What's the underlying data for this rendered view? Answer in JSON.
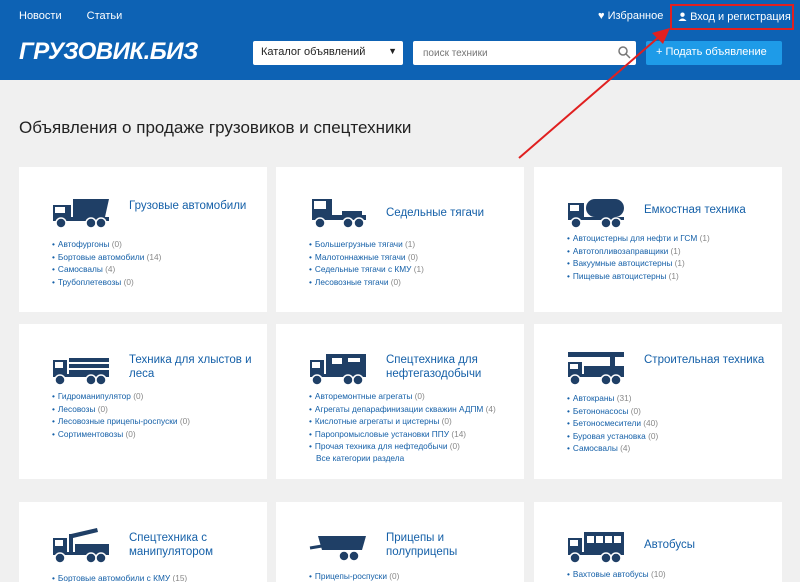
{
  "header": {
    "nav": [
      "Новости",
      "Статьи"
    ],
    "favorites": "Избранное",
    "login": "Вход и регистрация",
    "logo": "ГРУЗОВИК.БИЗ",
    "catalog_select": "Каталог объявлений",
    "search_placeholder": "поиск техники",
    "post_button": "+ Подать объявление"
  },
  "page_title": "Объявления о продаже грузовиков и спецтехники",
  "colors": {
    "header_bg": "#0d62b4",
    "accent": "#1e9be8",
    "link": "#1560a8",
    "highlight": "#e02020"
  },
  "cards": [
    {
      "title": "Грузовые автомобили",
      "icon": "dump-truck-icon",
      "items": [
        {
          "label": "Автофургоны",
          "count": "(0)"
        },
        {
          "label": "Бортовые автомобили",
          "count": "(14)"
        },
        {
          "label": "Самосвалы",
          "count": "(4)"
        },
        {
          "label": "Трубоплетевозы",
          "count": "(0)"
        }
      ]
    },
    {
      "title": "Седельные тягачи",
      "icon": "tractor-truck-icon",
      "items": [
        {
          "label": "Большегрузные тягачи",
          "count": "(1)"
        },
        {
          "label": "Малотоннажные тягачи",
          "count": "(0)"
        },
        {
          "label": "Седельные тягачи с КМУ",
          "count": "(1)"
        },
        {
          "label": "Лесовозные тягачи",
          "count": "(0)"
        }
      ]
    },
    {
      "title": "Емкостная техника",
      "icon": "tanker-truck-icon",
      "items": [
        {
          "label": "Автоцистерны для нефти и ГСМ",
          "count": "(1)"
        },
        {
          "label": "Автотопливозаправщики",
          "count": "(1)"
        },
        {
          "label": "Вакуумные автоцистерны",
          "count": "(1)"
        },
        {
          "label": "Пищевые автоцистерны",
          "count": "(1)"
        }
      ]
    },
    {
      "title": "Техника для хлыстов и леса",
      "icon": "timber-truck-icon",
      "items": [
        {
          "label": "Гидроманипулятор",
          "count": "(0)"
        },
        {
          "label": "Лесовозы",
          "count": "(0)"
        },
        {
          "label": "Лесовозные прицепы-роспуски",
          "count": "(0)"
        },
        {
          "label": "Сортиментовозы",
          "count": "(0)"
        }
      ]
    },
    {
      "title": "Спецтехника для нефтегазодобычи",
      "icon": "oilfield-truck-icon",
      "all": "Все категории раздела",
      "items": [
        {
          "label": "Авторемонтные агрегаты",
          "count": "(0)"
        },
        {
          "label": "Агрегаты депарафинизации скважин АДПМ",
          "count": "(4)"
        },
        {
          "label": "Кислотные агрегаты и цистерны",
          "count": "(0)"
        },
        {
          "label": "Паропромысловые установки ППУ",
          "count": "(14)"
        },
        {
          "label": "Прочая техника для нефтедобычи",
          "count": "(0)"
        }
      ]
    },
    {
      "title": "Строительная техника",
      "icon": "crane-truck-icon",
      "items": [
        {
          "label": "Автокраны",
          "count": "(31)"
        },
        {
          "label": "Бетононасосы",
          "count": "(0)"
        },
        {
          "label": "Бетоносмесители",
          "count": "(40)"
        },
        {
          "label": "Буровая установка",
          "count": "(0)"
        },
        {
          "label": "Самосвалы",
          "count": "(4)"
        }
      ]
    },
    {
      "title": "Спецтехника с манипулятором",
      "icon": "manipulator-truck-icon",
      "items": [
        {
          "label": "Бортовые автомобили с КМУ",
          "count": "(15)"
        }
      ]
    },
    {
      "title": "Прицепы и полуприцепы",
      "icon": "trailer-icon",
      "items": [
        {
          "label": "Прицепы-роспуски",
          "count": "(0)"
        }
      ]
    },
    {
      "title": "Автобусы",
      "icon": "bus-icon",
      "items": [
        {
          "label": "Вахтовые автобусы",
          "count": "(10)"
        }
      ]
    }
  ]
}
